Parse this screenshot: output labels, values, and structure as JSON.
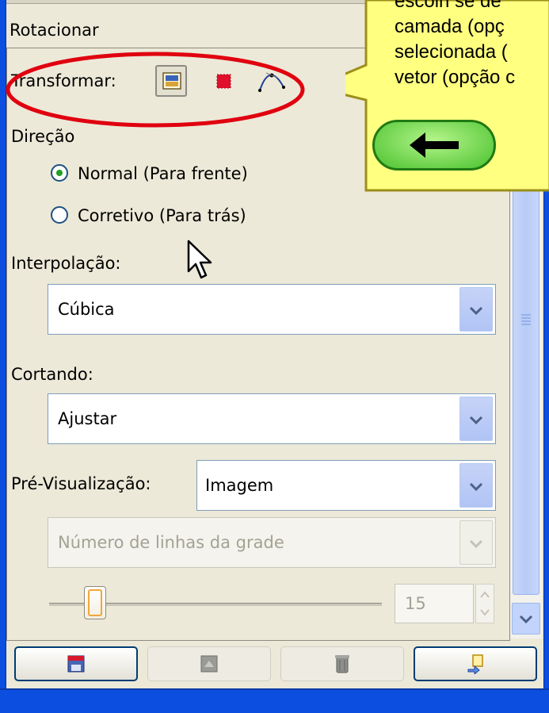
{
  "header": {
    "title": "Rotacionar"
  },
  "transform": {
    "label": "Transformar:",
    "options": [
      {
        "icon": "layer-icon",
        "selected": true
      },
      {
        "icon": "selection-icon",
        "selected": false
      },
      {
        "icon": "path-icon",
        "selected": false
      }
    ]
  },
  "direction": {
    "label": "Direção",
    "options": [
      {
        "label": "Normal (Para frente)",
        "checked": true
      },
      {
        "label": "Corretivo (Para trás)",
        "checked": false
      }
    ]
  },
  "interpolation": {
    "label": "Interpolação:",
    "value": "Cúbica"
  },
  "clipping": {
    "label": "Cortando:",
    "value": "Ajustar"
  },
  "preview": {
    "label": "Pré-Visualização:",
    "value": "Imagem",
    "grid_lines_option": "Número de linhas da grade",
    "grid_lines_value": "15",
    "grid_lines_enabled": false
  },
  "buttons": [
    {
      "icon": "save-icon",
      "enabled": true
    },
    {
      "icon": "restore-icon",
      "enabled": false
    },
    {
      "icon": "delete-icon",
      "enabled": false
    },
    {
      "icon": "reset-icon",
      "enabled": true
    }
  ],
  "callout": {
    "lines": [
      "escolh se de",
      "camada (opç",
      "selecionada (",
      "vetor (opção c"
    ],
    "back_icon": "left-arrow-icon",
    "color": "#ffff80"
  },
  "colors": {
    "frame": "#0b4ee0",
    "accent": "#21a121",
    "highlight": "#e0000f"
  }
}
